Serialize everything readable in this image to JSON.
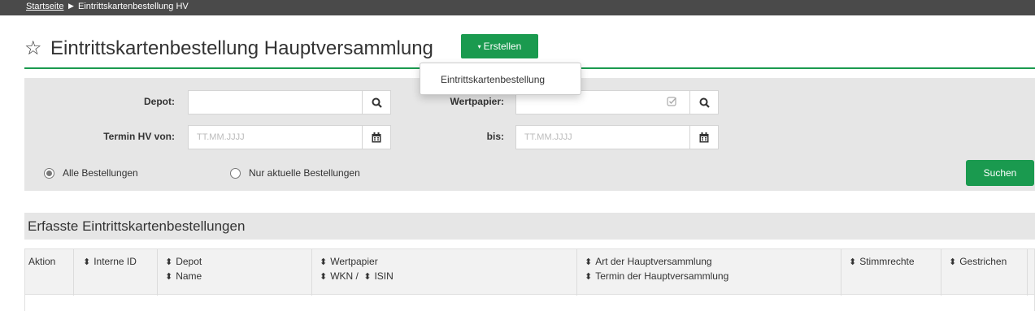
{
  "breadcrumb": {
    "home": "Startseite",
    "separator": "▶",
    "current": "Eintrittskartenbestellung HV"
  },
  "header": {
    "favorite_icon": "star-outline-icon",
    "title": "Eintrittskartenbestellung Hauptversammlung",
    "create_caret": "▾",
    "create_label": "Erstellen"
  },
  "create_menu": {
    "items": [
      "Eintrittskartenbestellung"
    ]
  },
  "filters": {
    "depot_label": "Depot:",
    "depot_value": "",
    "wertpapier_label": "Wertpapier:",
    "wertpapier_value": "",
    "termin_von_label": "Termin HV von:",
    "termin_von_placeholder": "TT.MM.JJJJ",
    "bis_label": "bis:",
    "bis_placeholder": "TT.MM.JJJJ",
    "radio_all": "Alle Bestellungen",
    "radio_current": "Nur aktuelle Bestellungen",
    "selected_radio": "Alle Bestellungen",
    "search_button": "Suchen"
  },
  "results": {
    "title": "Erfasste Eintrittskartenbestellungen",
    "sort_glyph": "⬍",
    "columns": {
      "aktion": "Aktion",
      "interne_id": "Interne ID",
      "depot": "Depot",
      "name": "Name",
      "wertpapier": "Wertpapier",
      "wkn": "WKN /",
      "isin": "ISIN",
      "art_hv": "Art der Hauptversammlung",
      "termin_hv": "Termin der Hauptversammlung",
      "stimmrechte": "Stimmrechte",
      "gestrichen": "Gestrichen"
    },
    "rows": []
  },
  "colors": {
    "accent": "#1a9a4f",
    "topbar": "#4a4a4a",
    "panel": "#e6e6e6"
  }
}
